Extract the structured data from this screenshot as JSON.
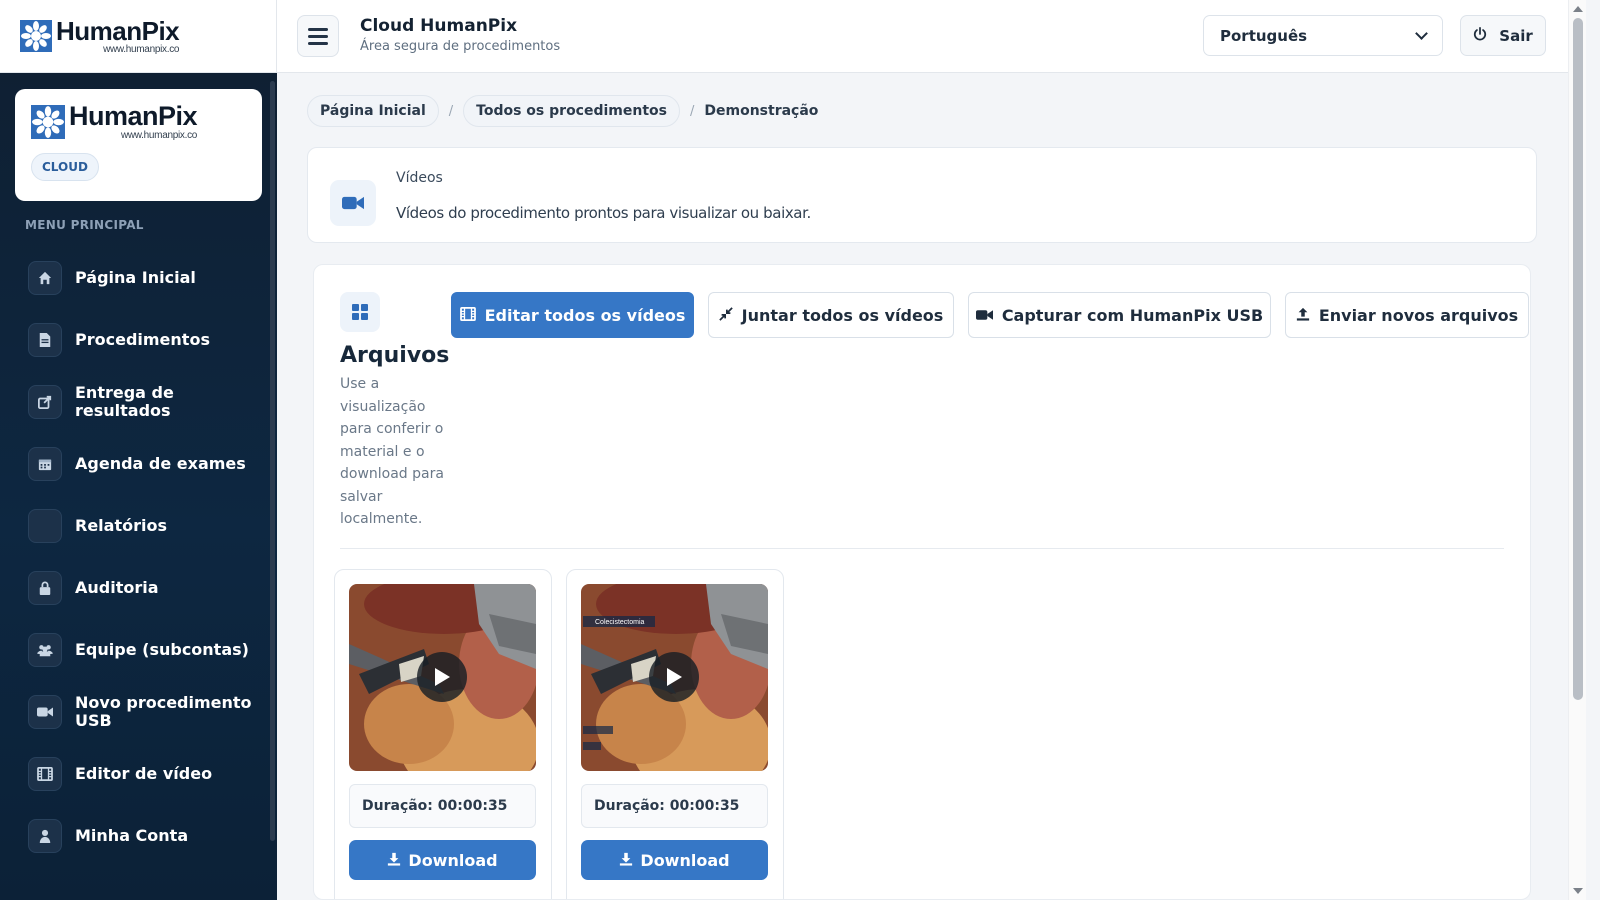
{
  "brand": {
    "name": "HumanPix",
    "url": "www.humanpix.co",
    "badge": "CLOUD"
  },
  "header": {
    "title": "Cloud HumanPix",
    "subtitle": "Área segura de procedimentos",
    "language": "Português",
    "logout_label": "Sair"
  },
  "sidebar": {
    "heading": "MENU PRINCIPAL",
    "items": [
      {
        "label": "Página Inicial",
        "icon": "home-icon"
      },
      {
        "label": "Procedimentos",
        "icon": "document-icon"
      },
      {
        "label": "Entrega de resultados",
        "icon": "share-icon"
      },
      {
        "label": "Agenda de exames",
        "icon": "calendar-icon"
      },
      {
        "label": "Relatórios",
        "icon": ""
      },
      {
        "label": "Auditoria",
        "icon": "lock-icon"
      },
      {
        "label": "Equipe (subcontas)",
        "icon": "users-icon"
      },
      {
        "label": "Novo procedimento USB",
        "icon": "video-camera-icon"
      },
      {
        "label": "Editor de vídeo",
        "icon": "film-icon"
      },
      {
        "label": "Minha Conta",
        "icon": "user-icon"
      }
    ]
  },
  "breadcrumb": {
    "items": [
      "Página Inicial",
      "Todos os procedimentos"
    ],
    "separator": "/",
    "current": "Demonstração"
  },
  "videos_card": {
    "title": "Vídeos",
    "description": "Vídeos do procedimento prontos para visualizar ou baixar."
  },
  "files": {
    "title": "Arquivos",
    "description": "Use a visualização para conferir o material e o download para salvar localmente.",
    "buttons": {
      "edit_all": "Editar todos os vídeos",
      "merge_all": "Juntar todos os vídeos",
      "capture_usb": "Capturar com HumanPix USB",
      "upload": "Enviar novos arquivos"
    },
    "videos": [
      {
        "duration": "Duração: 00:00:35",
        "download": "Download",
        "overlay_label": ""
      },
      {
        "duration": "Duração: 00:00:35",
        "download": "Download",
        "overlay_label": "Colecistectomia"
      }
    ]
  },
  "colors": {
    "sidebar_bg": "#0f2033",
    "accent": "#3677c6",
    "page_bg": "#f3f5f8"
  }
}
